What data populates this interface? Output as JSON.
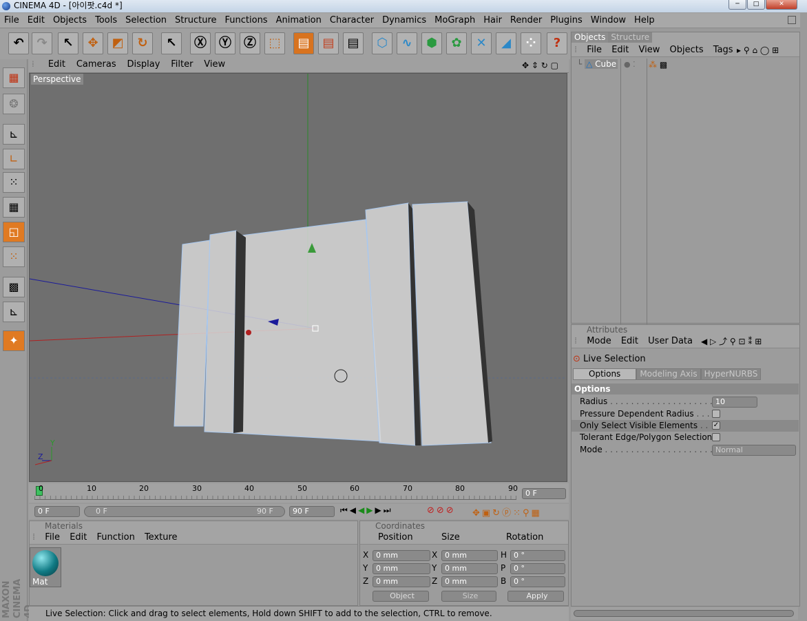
{
  "window": {
    "title": "CINEMA 4D - [아이팟.c4d *]",
    "min": "─",
    "max": "□",
    "close": "✕"
  },
  "menu": [
    "File",
    "Edit",
    "Objects",
    "Tools",
    "Selection",
    "Structure",
    "Functions",
    "Animation",
    "Character",
    "Dynamics",
    "MoGraph",
    "Hair",
    "Render",
    "Plugins",
    "Window",
    "Help"
  ],
  "viewport": {
    "menu": [
      "Edit",
      "Cameras",
      "Display",
      "Filter",
      "View"
    ],
    "label": "Perspective",
    "axis_y": "Y",
    "axis_z": "Z"
  },
  "timeline": {
    "ticks": [
      "0",
      "10",
      "20",
      "30",
      "40",
      "50",
      "60",
      "70",
      "80",
      "90"
    ],
    "current": "0 F",
    "start": "0 F",
    "range_start": "0 F",
    "range_end": "90 F",
    "end": "90 F"
  },
  "materials": {
    "header": "Materials",
    "menu": [
      "File",
      "Edit",
      "Function",
      "Texture"
    ],
    "items": [
      {
        "name": "Mat"
      }
    ]
  },
  "coords": {
    "header": "Coordinates",
    "cols": [
      "Position",
      "Size",
      "Rotation"
    ],
    "rows": [
      {
        "pl": "X",
        "p": "0 mm",
        "sl": "X",
        "s": "0 mm",
        "rl": "H",
        "r": "0 °"
      },
      {
        "pl": "Y",
        "p": "0 mm",
        "sl": "Y",
        "s": "0 mm",
        "rl": "P",
        "r": "0 °"
      },
      {
        "pl": "Z",
        "p": "0 mm",
        "sl": "Z",
        "s": "0 mm",
        "rl": "B",
        "r": "0 °"
      }
    ],
    "mode": "Object",
    "size_mode": "Size",
    "apply": "Apply"
  },
  "status": "Live Selection: Click and drag to select elements, Hold down SHIFT to add to the selection, CTRL to remove.",
  "objects": {
    "tabs": [
      "Objects",
      "Structure"
    ],
    "menu": [
      "File",
      "Edit",
      "View",
      "Objects",
      "Tags"
    ],
    "items": [
      {
        "name": "Cube"
      }
    ]
  },
  "attributes": {
    "header": "Attributes",
    "menu": [
      "Mode",
      "Edit",
      "User Data"
    ],
    "tool": "Live Selection",
    "tabs": [
      "Options",
      "Modeling Axis",
      "HyperNURBS"
    ],
    "section": "Options",
    "radius_label": "Radius",
    "radius_value": "10",
    "pressure_label": "Pressure Dependent Radius",
    "visible_label": "Only Select Visible Elements",
    "tolerant_label": "Tolerant Edge/Polygon Selection",
    "mode_label": "Mode",
    "mode_value": "Normal"
  },
  "logo": {
    "line1": "MAXON",
    "line2": "CINEMA 4D"
  }
}
